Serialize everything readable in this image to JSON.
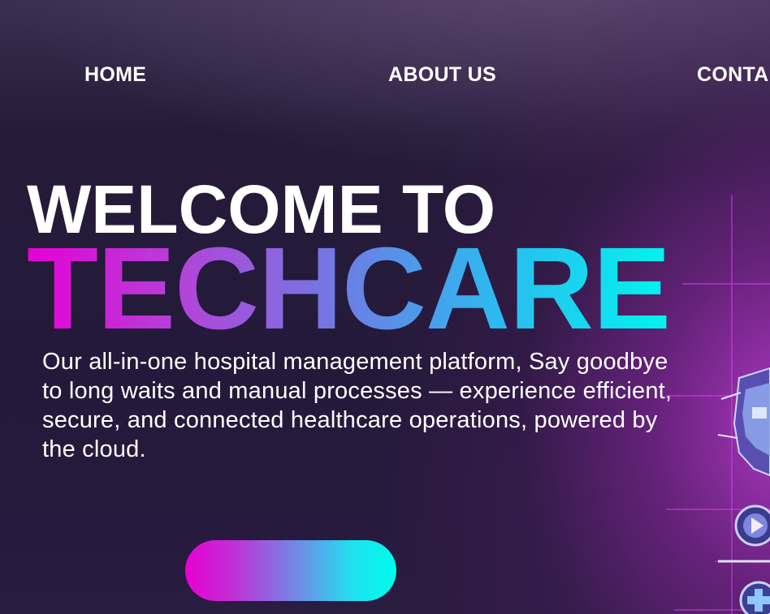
{
  "nav": {
    "items": [
      {
        "label": "HOME"
      },
      {
        "label": "ABOUT US"
      },
      {
        "label": "CONTA"
      }
    ]
  },
  "hero": {
    "welcome": "WELCOME TO",
    "brand": "TECHCARE",
    "tagline": "Our all-in-one hospital management platform, Say goodbye to long waits and manual processes — experience efficient, secure, and connected healthcare operations, powered by the cloud.",
    "cta_label": ""
  },
  "colors": {
    "background": "#231a36",
    "brand_gradient_start": "#e600d6",
    "brand_gradient_end": "#00f5ee",
    "accent_glow": "#c83cdc"
  },
  "icons": [
    "medical-shield-icon",
    "play-circle-icon",
    "medical-cross-icon"
  ]
}
